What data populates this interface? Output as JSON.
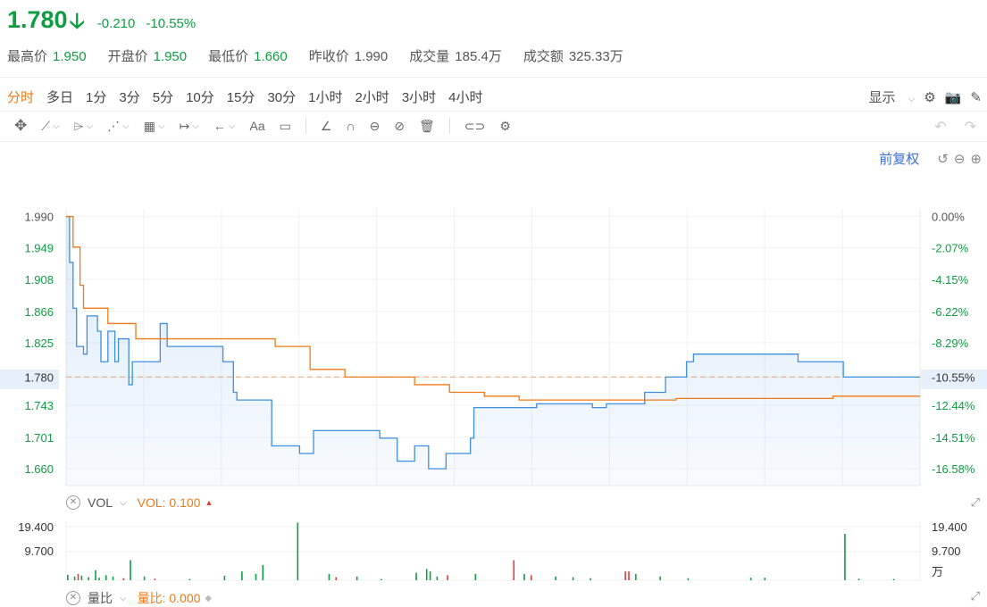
{
  "quote": {
    "price": "1.780",
    "arrow": "🡣",
    "change": "-0.210",
    "change_pct": "-10.55%"
  },
  "stats": [
    {
      "label": "最高价",
      "value": "1.950",
      "tone": "green"
    },
    {
      "label": "开盘价",
      "value": "1.950",
      "tone": "green"
    },
    {
      "label": "最低价",
      "value": "1.660",
      "tone": "green"
    },
    {
      "label": "昨收价",
      "value": "1.990",
      "tone": "neutral"
    },
    {
      "label": "成交量",
      "value": "185.4万",
      "tone": "neutral"
    },
    {
      "label": "成交额",
      "value": "325.33万",
      "tone": "neutral"
    }
  ],
  "periods": [
    "分时",
    "多日",
    "1分",
    "3分",
    "5分",
    "10分",
    "15分",
    "30分",
    "1小时",
    "2小时",
    "3小时",
    "4小时"
  ],
  "active_period": "分时",
  "toolbar_right": {
    "display_label": "显示"
  },
  "fuquan_label": "前复权",
  "chart_data": {
    "type": "line",
    "title": "",
    "price_axis_labels": [
      "1.990",
      "1.949",
      "1.908",
      "1.866",
      "1.825",
      "1.780",
      "1.743",
      "1.701",
      "1.660"
    ],
    "pct_axis_labels": [
      "0.00%",
      "-2.07%",
      "-4.15%",
      "-6.22%",
      "-8.29%",
      "-10.55%",
      "-12.44%",
      "-14.51%",
      "-16.58%"
    ],
    "ylim": [
      1.638,
      2.0
    ],
    "prev_close": 1.99,
    "last_price": 1.78,
    "series": [
      {
        "name": "price",
        "color": "#3d8fe0",
        "points": [
          [
            0,
            1.99
          ],
          [
            1,
            1.93
          ],
          [
            2,
            1.87
          ],
          [
            3,
            1.82
          ],
          [
            4,
            1.82
          ],
          [
            5,
            1.81
          ],
          [
            6,
            1.86
          ],
          [
            7,
            1.86
          ],
          [
            8,
            1.86
          ],
          [
            9,
            1.84
          ],
          [
            10,
            1.8
          ],
          [
            11,
            1.8
          ],
          [
            12,
            1.84
          ],
          [
            13,
            1.84
          ],
          [
            14,
            1.8
          ],
          [
            15,
            1.83
          ],
          [
            16,
            1.83
          ],
          [
            17,
            1.83
          ],
          [
            18,
            1.77
          ],
          [
            19,
            1.8
          ],
          [
            20,
            1.8
          ],
          [
            26,
            1.8
          ],
          [
            27,
            1.85
          ],
          [
            28,
            1.85
          ],
          [
            29,
            1.82
          ],
          [
            30,
            1.82
          ],
          [
            40,
            1.82
          ],
          [
            45,
            1.8
          ],
          [
            48,
            1.76
          ],
          [
            49,
            1.75
          ],
          [
            58,
            1.75
          ],
          [
            59,
            1.69
          ],
          [
            66,
            1.69
          ],
          [
            67,
            1.68
          ],
          [
            70,
            1.68
          ],
          [
            71,
            1.71
          ],
          [
            80,
            1.71
          ],
          [
            88,
            1.71
          ],
          [
            90,
            1.7
          ],
          [
            94,
            1.7
          ],
          [
            95,
            1.67
          ],
          [
            98,
            1.67
          ],
          [
            100,
            1.69
          ],
          [
            104,
            1.66
          ],
          [
            105,
            1.66
          ],
          [
            109,
            1.68
          ],
          [
            111,
            1.68
          ],
          [
            112,
            1.68
          ],
          [
            116,
            1.7
          ],
          [
            117,
            1.74
          ],
          [
            120,
            1.74
          ],
          [
            122,
            1.74
          ],
          [
            130,
            1.74
          ],
          [
            135,
            1.745
          ],
          [
            150,
            1.745
          ],
          [
            151,
            1.74
          ],
          [
            155,
            1.745
          ],
          [
            162,
            1.745
          ],
          [
            166,
            1.76
          ],
          [
            170,
            1.76
          ],
          [
            172,
            1.78
          ],
          [
            178,
            1.8
          ],
          [
            180,
            1.81
          ],
          [
            195,
            1.81
          ],
          [
            210,
            1.8
          ],
          [
            220,
            1.8
          ],
          [
            223,
            1.78
          ],
          [
            245,
            1.78
          ]
        ]
      },
      {
        "name": "avg",
        "color": "#f07a17",
        "points": [
          [
            0,
            1.99
          ],
          [
            2,
            1.95
          ],
          [
            4,
            1.9
          ],
          [
            5,
            1.87
          ],
          [
            12,
            1.85
          ],
          [
            20,
            1.83
          ],
          [
            60,
            1.82
          ],
          [
            70,
            1.79
          ],
          [
            80,
            1.78
          ],
          [
            95,
            1.78
          ],
          [
            100,
            1.77
          ],
          [
            110,
            1.76
          ],
          [
            120,
            1.755
          ],
          [
            130,
            1.75
          ],
          [
            150,
            1.75
          ],
          [
            175,
            1.752
          ],
          [
            220,
            1.755
          ],
          [
            245,
            1.755
          ]
        ]
      }
    ],
    "volume": {
      "label": "VOL",
      "indicator": "VOL: 0.100",
      "axis_labels": [
        "19.400",
        "9.700"
      ],
      "unit": "万",
      "bars": [
        [
          0,
          2.2,
          "g"
        ],
        [
          2,
          1.5,
          "g"
        ],
        [
          3,
          2.5,
          "r"
        ],
        [
          4,
          1.8,
          "g"
        ],
        [
          6,
          1.2,
          "g"
        ],
        [
          8,
          4.0,
          "g"
        ],
        [
          9,
          1.0,
          "g"
        ],
        [
          11,
          2.0,
          "g"
        ],
        [
          13,
          1.5,
          "g"
        ],
        [
          16,
          0.8,
          "r"
        ],
        [
          18,
          8.0,
          "g"
        ],
        [
          22,
          1.5,
          "g"
        ],
        [
          25,
          0.6,
          "r"
        ],
        [
          35,
          0.5,
          "g"
        ],
        [
          45,
          1.8,
          "g"
        ],
        [
          50,
          3.5,
          "g"
        ],
        [
          54,
          2.5,
          "g"
        ],
        [
          56,
          6.0,
          "g"
        ],
        [
          66,
          23.0,
          "g"
        ],
        [
          75,
          2.5,
          "g"
        ],
        [
          77,
          1.2,
          "r"
        ],
        [
          83,
          1.5,
          "g"
        ],
        [
          90,
          0.5,
          "g"
        ],
        [
          100,
          3.0,
          "g"
        ],
        [
          103,
          4.5,
          "g"
        ],
        [
          104,
          3.5,
          "g"
        ],
        [
          106,
          1.5,
          "g"
        ],
        [
          109,
          2.0,
          "r"
        ],
        [
          117,
          2.5,
          "g"
        ],
        [
          128,
          8.0,
          "r"
        ],
        [
          131,
          2.5,
          "g"
        ],
        [
          133,
          2.0,
          "r"
        ],
        [
          140,
          1.5,
          "g"
        ],
        [
          145,
          1.2,
          "g"
        ],
        [
          150,
          0.8,
          "g"
        ],
        [
          160,
          3.5,
          "r"
        ],
        [
          161,
          3.5,
          "r"
        ],
        [
          163,
          2.5,
          "g"
        ],
        [
          170,
          1.5,
          "g"
        ],
        [
          178,
          0.8,
          "g"
        ],
        [
          196,
          1.0,
          "g"
        ],
        [
          200,
          1.0,
          "g"
        ],
        [
          223,
          18.5,
          "g"
        ],
        [
          227,
          0.6,
          "g"
        ],
        [
          237,
          0.5,
          "g"
        ]
      ]
    },
    "ratio": {
      "label": "量比",
      "indicator": "量比: 0.000"
    }
  }
}
